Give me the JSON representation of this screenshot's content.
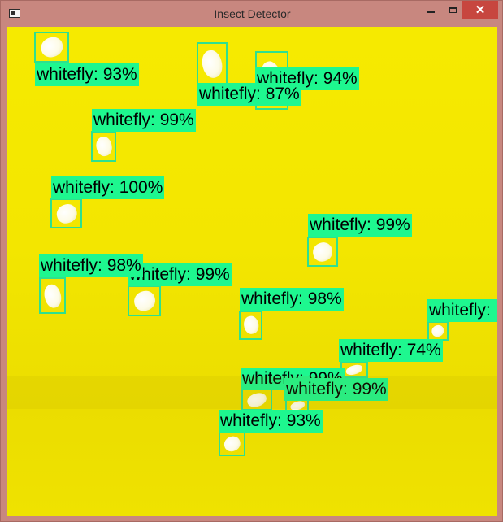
{
  "window": {
    "title": "Insect Detector",
    "controls": {
      "minimize": "minimize-icon",
      "maximize": "maximize-icon",
      "close": "✕"
    }
  },
  "colors": {
    "background": "#f3e600",
    "box": "#2fe08f",
    "label_bg": "#1ef78f"
  },
  "detections": [
    {
      "label": "whitefly: 93%"
    },
    {
      "label": "whitefly: 94%"
    },
    {
      "label": "whitefly: 87%"
    },
    {
      "label": "whitefly: 99%"
    },
    {
      "label": "whitefly: 100%"
    },
    {
      "label": "whitefly: 99%"
    },
    {
      "label": "whitefly: 99%"
    },
    {
      "label": "whitefly: 98%"
    },
    {
      "label": "whitefly: 98%"
    },
    {
      "label": "whitefly:"
    },
    {
      "label": "whitefly: 74%"
    },
    {
      "label": "whitefly: 99%"
    },
    {
      "label": "whitefly: 99%"
    },
    {
      "label": "whitefly: 93%"
    }
  ]
}
